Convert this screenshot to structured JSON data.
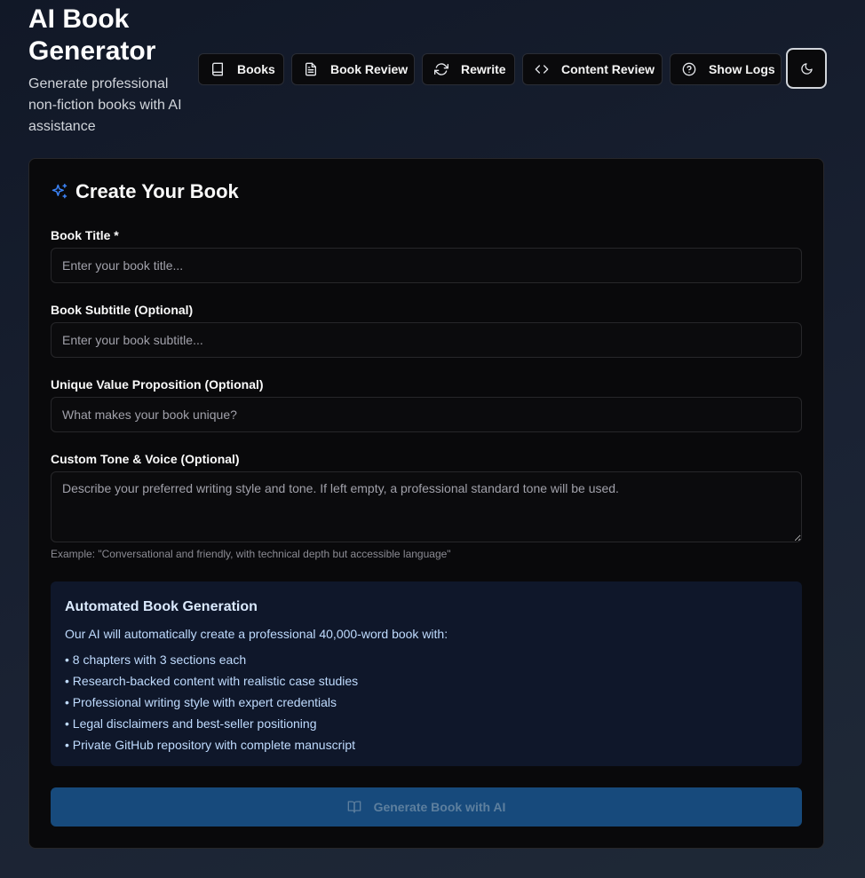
{
  "header": {
    "title": "AI Book Generator",
    "subtitle": "Generate professional non-fiction books with AI assistance"
  },
  "nav": [
    {
      "label": "Books",
      "icon": "book-icon"
    },
    {
      "label": "Book Review",
      "icon": "file-text-icon"
    },
    {
      "label": "Rewrite",
      "icon": "refresh-icon"
    },
    {
      "label": "Content Review",
      "icon": "code-icon"
    },
    {
      "label": "Show Logs",
      "icon": "help-circle-icon"
    }
  ],
  "theme_toggle": {
    "icon": "moon-icon"
  },
  "form": {
    "title": "Create Your Book",
    "title_icon": "sparkles-icon",
    "fields": {
      "book_title": {
        "label": "Book Title *",
        "placeholder": "Enter your book title...",
        "value": ""
      },
      "book_subtitle": {
        "label": "Book Subtitle (Optional)",
        "placeholder": "Enter your book subtitle...",
        "value": ""
      },
      "uvp": {
        "label": "Unique Value Proposition (Optional)",
        "placeholder": "What makes your book unique?",
        "value": ""
      },
      "tone": {
        "label": "Custom Tone & Voice (Optional)",
        "placeholder": "Describe your preferred writing style and tone. If left empty, a professional standard tone will be used.",
        "value": "",
        "hint": "Example: \"Conversational and friendly, with technical depth but accessible language\""
      }
    },
    "info": {
      "title": "Automated Book Generation",
      "intro": "Our AI will automatically create a professional 40,000-word book with:",
      "items": [
        "• 8 chapters with 3 sections each",
        "• Research-backed content with realistic case studies",
        "• Professional writing style with expert credentials",
        "• Legal disclaimers and best-seller positioning",
        "• Private GitHub repository with complete manuscript"
      ]
    },
    "submit": {
      "label": "Generate Book with AI",
      "icon": "book-open-icon",
      "disabled": true
    }
  },
  "colors": {
    "accent": "#3b82f6",
    "button_disabled_bg": "#174a7c",
    "card_bg": "#09090b",
    "info_bg": "#0f172a"
  }
}
